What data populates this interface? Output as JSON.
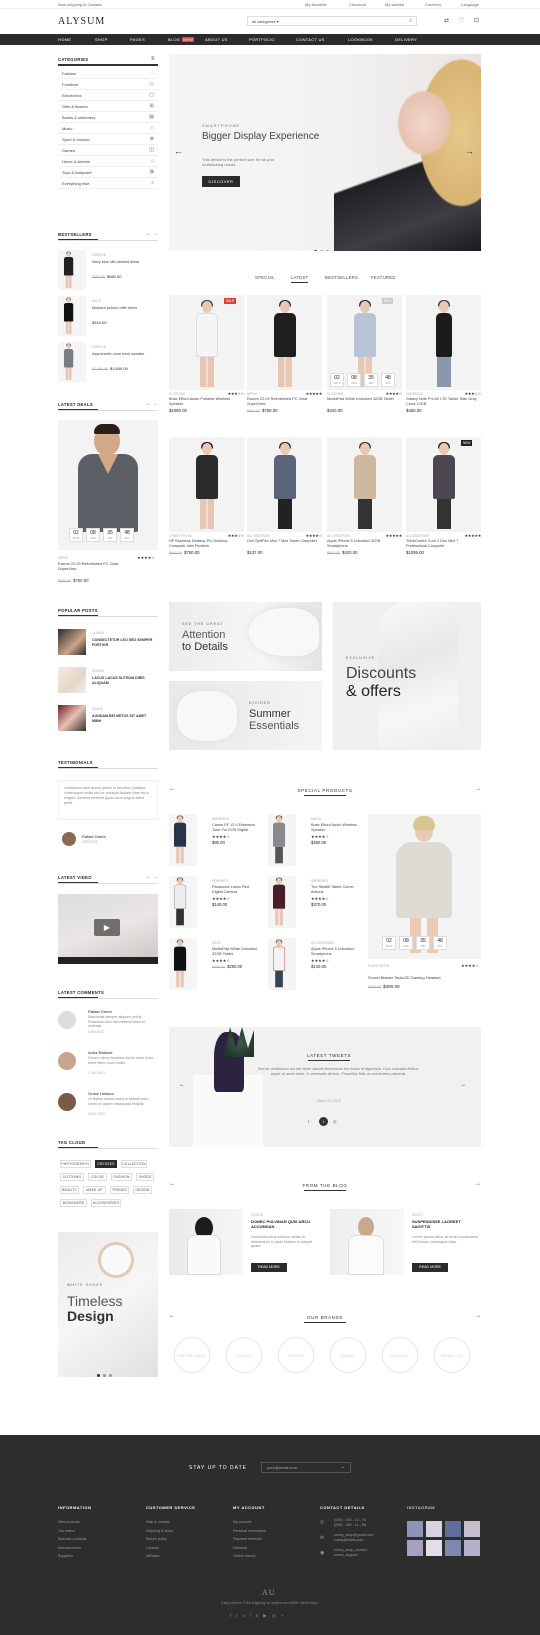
{
  "topbar": {
    "shipping": "Now shipping to Canada",
    "links": [
      "My favorites",
      "Checkout",
      "My wishlist",
      "Currency",
      "Language"
    ]
  },
  "header": {
    "logo": "ALYSUM",
    "search_category": "all categories"
  },
  "nav": [
    "HOME",
    "SHOP",
    "PAGES",
    "BLOG",
    "ABOUT US",
    "PORTFOLIO",
    "CONTACT US",
    "LOOKBOOK",
    "DELIVERY"
  ],
  "nav_badge": "NEW",
  "categories": {
    "title": "CATEGORIES",
    "items": [
      "Fashion",
      "Furniture",
      "Electronics",
      "Gifts & flowers",
      "Books & stationery",
      "Music",
      "Sport & tourism",
      "Games",
      "Home & kitchen",
      "Toys & babycare",
      "Everything else"
    ]
  },
  "slider": {
    "sub": "SMARTPHONE",
    "title": "Bigger Display Experience",
    "desc": "This device is the perfect size for all your multitasking needs.",
    "button": "DISCOVER"
  },
  "tabs": [
    "SPECIAL",
    "LATEST",
    "BESTSELLERS",
    "FEATURED"
  ],
  "products": [
    {
      "cat": "CLOTHING",
      "name": "Bose Efford Audio Portable Wireless Speaker",
      "price": "$1050.00",
      "old": "",
      "tag": "SALE"
    },
    {
      "cat": "APPLE",
      "name": "Eacom 22-09 Refurbished PC Clear SuperView",
      "price": "$750.00",
      "old": "$800.00",
      "tag": ""
    },
    {
      "cat": "CLOTHING",
      "name": "MediaPad White Unlocked 32GB Tablet",
      "price": "$420.00",
      "old": "",
      "tag": "NEW"
    },
    {
      "cat": "ANDROIDS",
      "name": "Galaxy Note Pro 60 LTE Tablet Titan Gray Clock 10GB",
      "price": "$450.00",
      "old": "Titan Gray",
      "tag": ""
    },
    {
      "cat": "CYBER PHONE",
      "name": "HP Business Desktop Pro Desktop Computer Intel Pentium",
      "price": "$760.00",
      "old": "$800.00",
      "tag": ""
    },
    {
      "cat": "ACCESSORIES",
      "name": "Dell OptiPlex Mini 7 Mini Tower Computer",
      "price": "$137.00",
      "old": "",
      "tag": ""
    },
    {
      "cat": "ACCESSORIES",
      "name": "Apple iPhone 5 Unlocked 32GB Smartphone",
      "price": "$420.00",
      "old": "$500.00",
      "tag": ""
    },
    {
      "cat": "ACCESSORIES",
      "name": "ThinkCentre Core 2 Duo Mini 7 Professional Computer",
      "price": "$1095.00",
      "old": "",
      "tag": "NEW"
    }
  ],
  "countdown": {
    "d": "02",
    "h": "08",
    "m": "35",
    "s": "48",
    "labels": [
      "DAYS",
      "HRS",
      "MIN",
      "SEC"
    ]
  },
  "bestsellers": {
    "title": "BESTSELLERS",
    "items": [
      {
        "cat": "FASHION",
        "name": "Navy blue silk pleated dress",
        "price": "$980.00",
        "old": "$990.00"
      },
      {
        "cat": "BAGS",
        "name": "Mustard yellow ruffle dress",
        "price": "$310.00",
        "old": ""
      },
      {
        "cat": "FASHION",
        "name": "Asymmetric cone neck sweater",
        "price": "$1,600.00",
        "old": "$1,650.00"
      }
    ]
  },
  "latest_deals": {
    "title": "LATEST DEALS",
    "cat": "APPLE",
    "name": "Eacom 22-09 Refurbished PC Clear SuperView",
    "price": "$750.00",
    "old": "$800.00"
  },
  "banners": {
    "b1_sub": "SEE THE GREAT",
    "b1_title1": "Attention",
    "b1_title2": "to Details",
    "b2_sub": "EXCLUSIVE",
    "b2_title1": "Discounts",
    "b2_title2": "& offers",
    "b3_sub": "DIVIDED",
    "b3_title1": "Summer",
    "b3_title2": "Essentials"
  },
  "popular_posts": {
    "title": "POPULAR POSTS",
    "items": [
      {
        "date": "14 MON",
        "title": "CONSECTETUR LEO SED SEMPER FORTIOR"
      },
      {
        "date": "22 MON",
        "title": "LACUS LACUS SUTRUM DIRIS ALIQUAM"
      },
      {
        "date": "03 AUS",
        "title": "AUNDAM BEI METUS SIT AMET MIBH"
      }
    ]
  },
  "testimonials": {
    "title": "TESTIMONIALS",
    "text": "Vestibulum ante ipsum primis in faucibus Quisque scelerisque mollis nisl ac volutpat Nullam vitae est a magna. Aenean eleifend ligula risus magna tellus pede.",
    "name": "Rafael Green",
    "role": "CREATIVE"
  },
  "latest_video": {
    "title": "LATEST VIDEO"
  },
  "latest_comments": {
    "title": "LATEST COMMENTS",
    "items": [
      {
        "name": "Rafael Green",
        "text": "Maecenas semper aliquam mollis Phasellus arcu nisi eleifend tellus et molestie.",
        "date": "3 MIN AGO"
      },
      {
        "name": "Anna Ratzlick",
        "text": "Donec rutrum faucibus nisi sit amet tortor fusce Nunc nunc mollis.",
        "date": "1 DAY AGO"
      },
      {
        "name": "Grace Hudson",
        "text": "Ut finibus lectus neque in blandit enim lorem ut sapien malesuada fringilla.",
        "date": "3 DAY AGO"
      }
    ]
  },
  "tag_cloud": {
    "title": "TAG CLOUD",
    "tags": [
      "PHOTOGRAPHY",
      "DRESSES",
      "COLLECTION",
      "CLOTHING",
      "COLOR",
      "FASHION",
      "SHOES",
      "BEAUTY",
      "MAKE UP",
      "TRENDS",
      "DESIGN",
      "DESIGNERS",
      "ACCESSORIES"
    ]
  },
  "sidebar_banner": {
    "sub": "WHITE SHOES",
    "title1": "Timeless",
    "title2": "Design"
  },
  "special_products": {
    "title": "SPECIAL PRODUCTS",
    "items": [
      {
        "cat": "ANDROIDS",
        "name": "Canon EF 12 II Extension Tube For EOS Digital",
        "price": "$95.00"
      },
      {
        "cat": "AUDIO",
        "name": "Bose Efford Audio Wireless Speaker",
        "price": "$480.00"
      },
      {
        "cat": "GRAPHICS",
        "name": "Panasonic Lumix Red Digital Camera",
        "price": "$140.00"
      },
      {
        "cat": "ANDROIDS",
        "name": "Trio Stealth Tablet Comer Actions",
        "price": "$370.00"
      },
      {
        "cat": "ASUS",
        "name": "MediaPad White Unlocked 32GB Tablet",
        "price": "$290.00",
        "old": "$300.00"
      },
      {
        "cat": "ACCESSORIES",
        "name": "Apple iPhone 5 Unlocked Smartphone",
        "price": "$140.00"
      }
    ],
    "featured": {
      "cat": "PLAYSTATION",
      "name": "Sound Blaster Tactic3D Gaming Headset",
      "price": "$380.00",
      "old": "$400.00"
    }
  },
  "tweets": {
    "title": "LATEST TWEETS",
    "text": "Sed ac vestibulum dui nec dolor blandit fermentum est luctus et dignissim. Duis convallis finibus turpis sit amet tortor. In venenatis dictum. Phasellus felis ut consectetur placerat",
    "date": "March 13, 2016"
  },
  "blog": {
    "title": "FROM THE BLOG",
    "items": [
      {
        "date": "22 MON",
        "title": "DONEC PULVINAR QUIS ARCU ACCUMSAN",
        "text": "Vivamus luctus sancus metus in elementum in justo Nullam in aliquet quam",
        "button": "READ MORE"
      },
      {
        "date": "08 OCT",
        "title": "SUSPENDISSE LAOREET SAGITTIS",
        "text": "Lorem ipsum dolor sit amet consectetur elit Donec consequat vitae",
        "button": "READ MORE"
      }
    ]
  },
  "brands": {
    "title": "OUR BRANDS",
    "items": [
      "THE PRUDENT",
      "JOLOGY",
      "PHOTO",
      "BRAND",
      "HOLIDAY",
      "BRAND CO",
      "BRAND"
    ]
  },
  "newsletter": {
    "title": "STAY UP TO DATE",
    "placeholder": "your@email.com"
  },
  "footer": {
    "cols": [
      {
        "title": "INFORMATION",
        "links": [
          "New products",
          "Top sellers",
          "Specials products",
          "Manufacturers",
          "Suppliers"
        ]
      },
      {
        "title": "CUSTOMER SERVICE",
        "links": [
          "Help & contact",
          "Shipping & taxes",
          "Return policy",
          "Careers",
          "Affiliates"
        ]
      },
      {
        "title": "MY ACCOUNT",
        "links": [
          "My account",
          "Personal information",
          "Payment methods",
          "Discount",
          "Orders history"
        ]
      },
      {
        "title": "CONTACT DETAILS",
        "links": [
          "(000) - 000 - 14 - 70",
          "(000) - 000 - 11 - 96",
          "sunny_shop@gmail.com",
          "sunny@sales.com",
          "sunny_shop_contact",
          "sunny_support"
        ]
      }
    ],
    "instagram": "INSTAGRAM",
    "logo": "AU",
    "bottom": "Easy returns. Free shipping on orders over $100. Need help?"
  },
  "colors": {
    "dark": "#2b2b2b",
    "sale": "#d9443a"
  }
}
